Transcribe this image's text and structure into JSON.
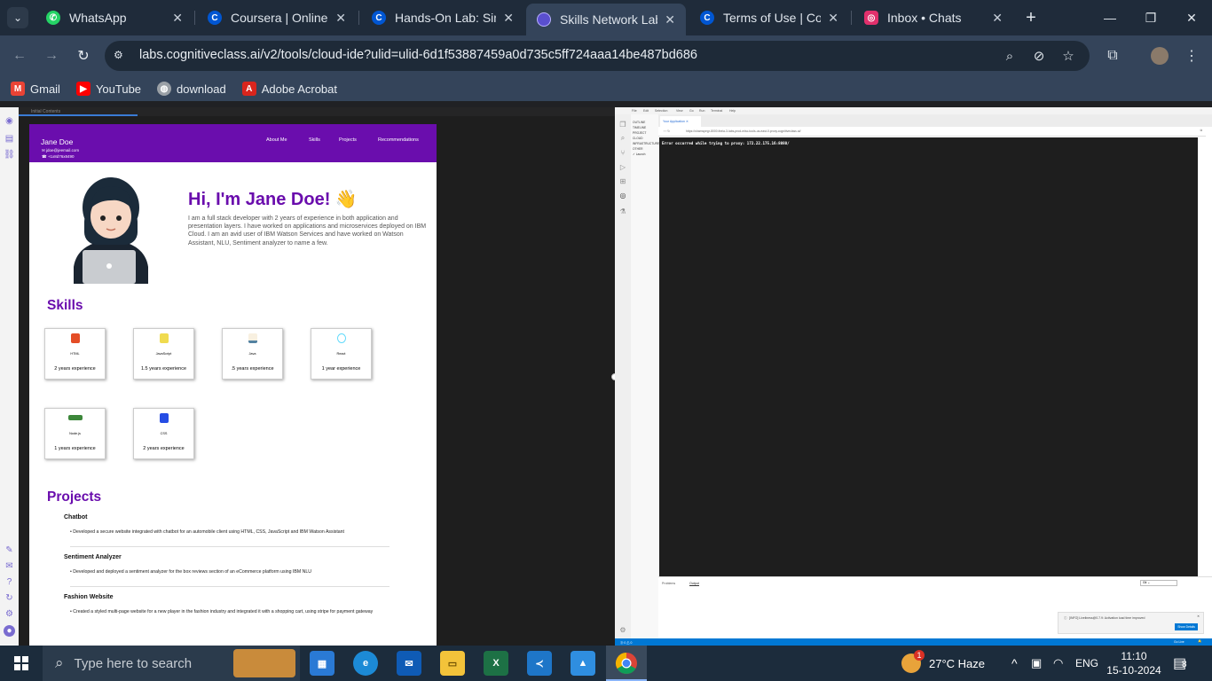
{
  "browser": {
    "tabs": [
      {
        "title": "WhatsApp",
        "icon": "whatsapp-icon",
        "color": "#25d366",
        "active": false
      },
      {
        "title": "Coursera | Online Cou",
        "icon": "coursera-icon",
        "color": "#0056d2",
        "active": false
      },
      {
        "title": "Hands-On Lab: Single",
        "icon": "coursera-icon",
        "color": "#0056d2",
        "active": false
      },
      {
        "title": "Skills Network Labs",
        "icon": "skills-network-icon",
        "color": "#5a4fcf",
        "active": true
      },
      {
        "title": "Terms of Use | Course",
        "icon": "coursera-icon",
        "color": "#0056d2",
        "active": false
      },
      {
        "title": "Inbox • Chats",
        "icon": "instagram-icon",
        "color": "#e1306c",
        "active": false
      }
    ],
    "new_tab": "+",
    "url": "labs.cognitiveclass.ai/v2/tools/cloud-ide?ulid=ulid-6d1f53887459a0d735c5ff724aaa14be487bd686",
    "bookmarks": [
      {
        "label": "Gmail",
        "icon": "gmail-icon",
        "color": "#ea4335"
      },
      {
        "label": "YouTube",
        "icon": "youtube-icon",
        "color": "#ff0000"
      },
      {
        "label": "download",
        "icon": "globe-icon",
        "color": "#9aa0a6"
      },
      {
        "label": "Adobe Acrobat",
        "icon": "acrobat-icon",
        "color": "#d9251d"
      }
    ]
  },
  "preview": {
    "top_label": "Initial Contents",
    "site": {
      "name": "Jane Doe",
      "email": "jdoe@jeemail.com",
      "phone": "+1x8d76x8490",
      "nav": [
        "About Me",
        "Skills",
        "Projects",
        "Recommendations"
      ],
      "greeting": "Hi, I'm Jane Doe! 👋",
      "intro": "I am a full stack developer with 2 years of experience in both application and presentation layers. I have worked on applications and microservices deployed on IBM Cloud. I am an avid user of IBM Watson Services and have worked on Watson Assistant, NLU, Sentiment analyzer to name a few.",
      "skills_title": "Skills",
      "skills": [
        {
          "name": "HTML",
          "exp": "2 years experience",
          "icon": "html5-icon",
          "color": "#e44d26"
        },
        {
          "name": "JavaScript",
          "exp": "1.5 years experience",
          "icon": "javascript-icon",
          "color": "#f0db4f"
        },
        {
          "name": "Java",
          "exp": ".5 years experience",
          "icon": "java-icon",
          "color": "#5382a1"
        },
        {
          "name": "React",
          "exp": "1 year experience",
          "icon": "react-icon",
          "color": "#61dafb"
        },
        {
          "name": "Node.js",
          "exp": "1 years experience",
          "icon": "nodejs-icon",
          "color": "#3c873a"
        },
        {
          "name": "CSS",
          "exp": "2 years experience",
          "icon": "css3-icon",
          "color": "#264de4"
        }
      ],
      "projects_title": "Projects",
      "projects": [
        {
          "title": "Chatbot",
          "desc": "Developed a secure website integrated with chatbot for an automobile client using HTML, CSS, JavaScript and IBM Watson Assistant"
        },
        {
          "title": "Sentiment Analyzer",
          "desc": "Developed and deployed a sentiment analyzer for the box reviews section of an eCommerce platform using IBM NLU"
        },
        {
          "title": "Fashion Website",
          "desc": "Created a styled multi-page website for a new player in the fashion industry and integrated it with a shopping cart, using stripe for payment gateway"
        }
      ]
    }
  },
  "ide": {
    "menu": [
      "File",
      "Edit",
      "Selection",
      "View",
      "Go",
      "Run",
      "Terminal",
      "Help"
    ],
    "explorer": [
      "OUTLINE",
      "TIMELINE",
      "PROJECT",
      "CLOUD INFRASTRUCTURE",
      "OTHER"
    ],
    "launch_label": "Launch",
    "editor_tab": "Your Application",
    "webview_url": "https://shamspegr-8000.theia-3-labs-prod-misc-tools-us-east-0.proxy.cognitiveclass.ai/",
    "error_message": "Error occurred while trying to proxy: 172.22.175.16:8080/",
    "panel_tabs": [
      "Problems",
      "Output"
    ],
    "panel_select": "Git",
    "notification": "[INFO] Liveliness@0.7.9: Activation load time improved",
    "notification_button": "Show Details",
    "status_left": "⓪ 0 ⚠ 0",
    "status_right": "Go Live"
  },
  "taskbar": {
    "search_placeholder": "Type here to search",
    "weather": "27°C Haze",
    "weather_badge": "1",
    "language": "ENG",
    "time": "11:10",
    "date": "15-10-2024",
    "notifications": "8"
  }
}
